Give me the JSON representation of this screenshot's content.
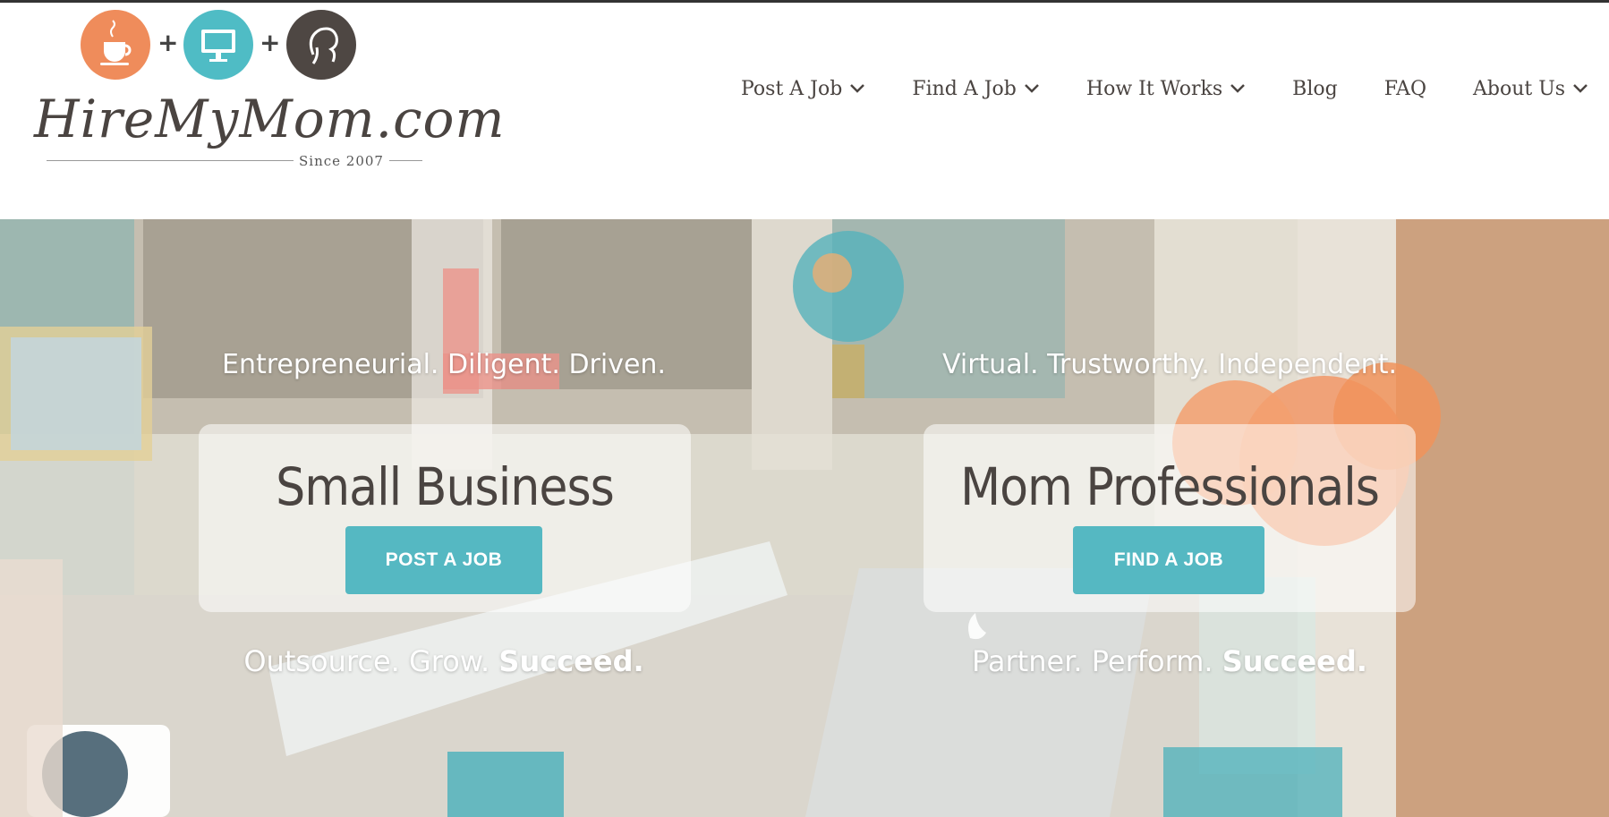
{
  "logo": {
    "wordmark": "HireMyMom.com",
    "since": "Since 2007",
    "icons": [
      "coffee-cup-icon",
      "computer-monitor-icon",
      "mom-silhouette-icon"
    ]
  },
  "nav": {
    "items": [
      {
        "label": "Post A Job",
        "has_dropdown": true
      },
      {
        "label": "Find A Job",
        "has_dropdown": true
      },
      {
        "label": "How It Works",
        "has_dropdown": true
      },
      {
        "label": "Blog",
        "has_dropdown": false
      },
      {
        "label": "FAQ",
        "has_dropdown": false
      },
      {
        "label": "About Us",
        "has_dropdown": true
      }
    ]
  },
  "hero": {
    "left": {
      "tagline": "Entrepreneurial. Diligent. Driven.",
      "title": "Small Business",
      "button": "POST A JOB",
      "sub_prefix": "Outsource. Grow. ",
      "sub_bold": "Succeed."
    },
    "right": {
      "tagline": "Virtual. Trustworthy. Independent.",
      "title": "Mom Professionals",
      "button": "FIND A JOB",
      "sub_prefix": "Partner. Perform. ",
      "sub_bold": "Succeed."
    }
  },
  "colors": {
    "accent": "#55b8c2",
    "orange": "#ef8c5b",
    "dark": "#4a4441"
  }
}
